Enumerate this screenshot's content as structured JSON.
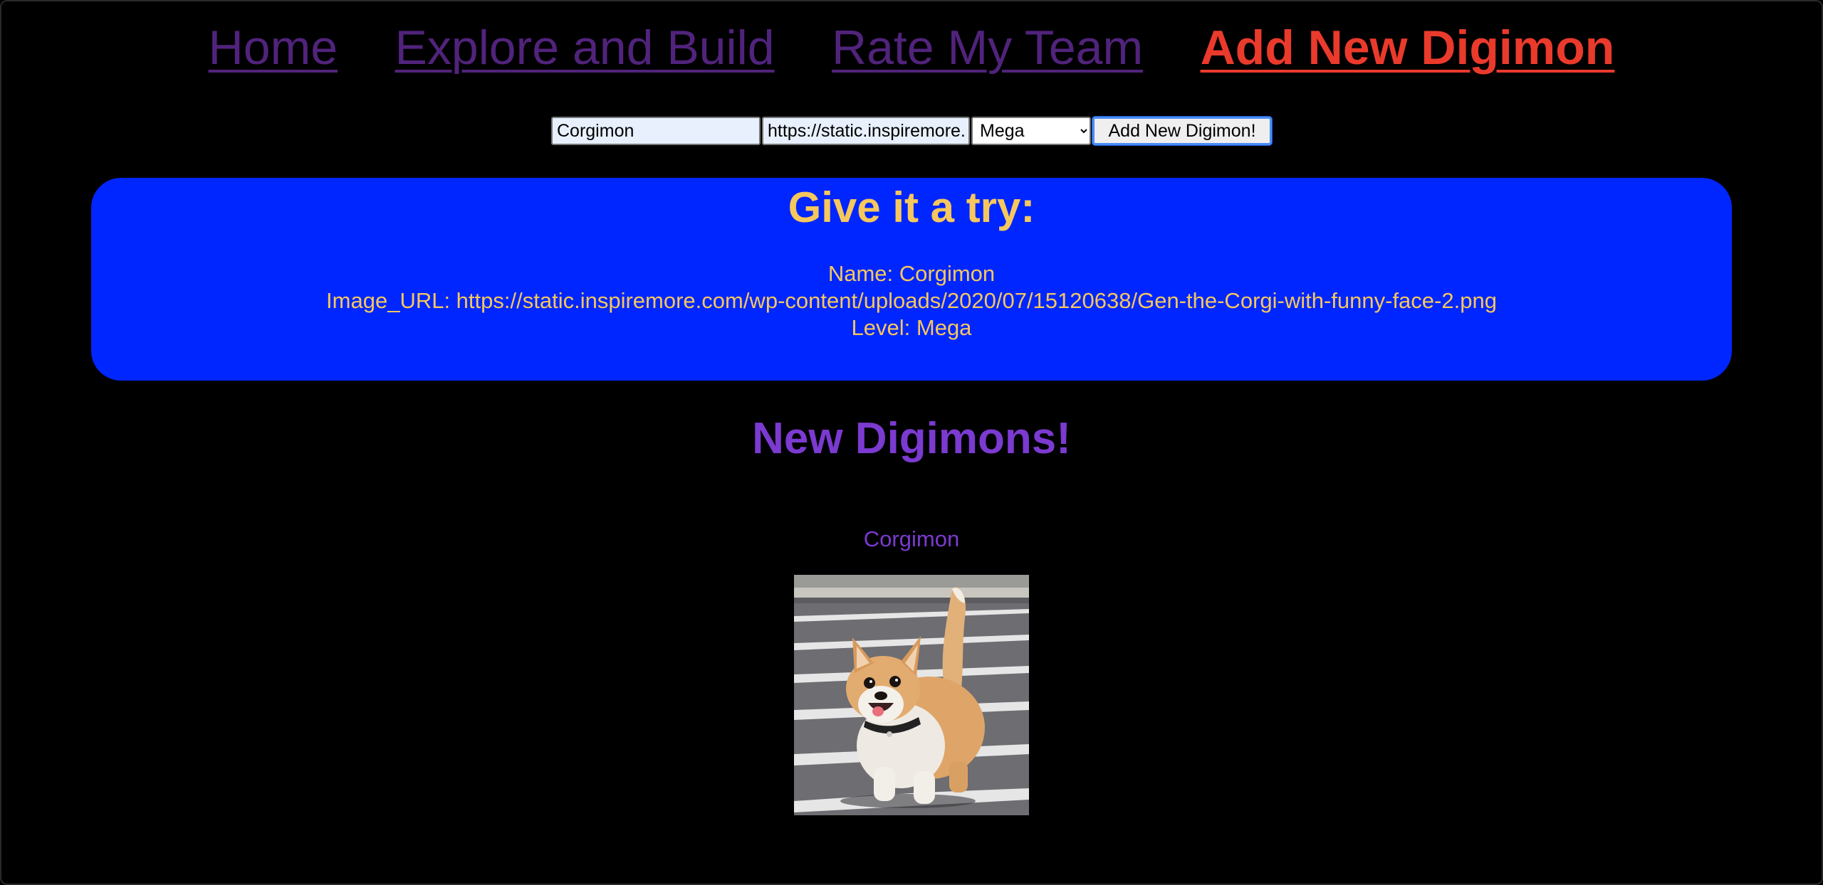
{
  "nav": {
    "home": "Home",
    "explore": "Explore and Build",
    "rate": "Rate My Team",
    "add": "Add New Digimon"
  },
  "form": {
    "name_value": "Corgimon",
    "url_value": "https://static.inspiremore.com/wp-content/uploads/2020/07/15120638/Gen-the-Corgi-with-funny-face-2.png",
    "level_selected": "Mega",
    "submit_label": "Add New Digimon!"
  },
  "preview": {
    "heading": "Give it a try:",
    "name_line": "Name: Corgimon",
    "url_line": "Image_URL: https://static.inspiremore.com/wp-content/uploads/2020/07/15120638/Gen-the-Corgi-with-funny-face-2.png",
    "level_line": "Level: Mega"
  },
  "list": {
    "heading": "New Digimons!",
    "items": [
      {
        "name": "Corgimon",
        "image": "corgi-photo"
      }
    ]
  },
  "colors": {
    "background": "#000000",
    "nav_link": "#51237c",
    "nav_active": "#ea3a2c",
    "preview_bg": "#0026ff",
    "preview_text": "#f6c75c",
    "list_text": "#7b3ad0"
  }
}
